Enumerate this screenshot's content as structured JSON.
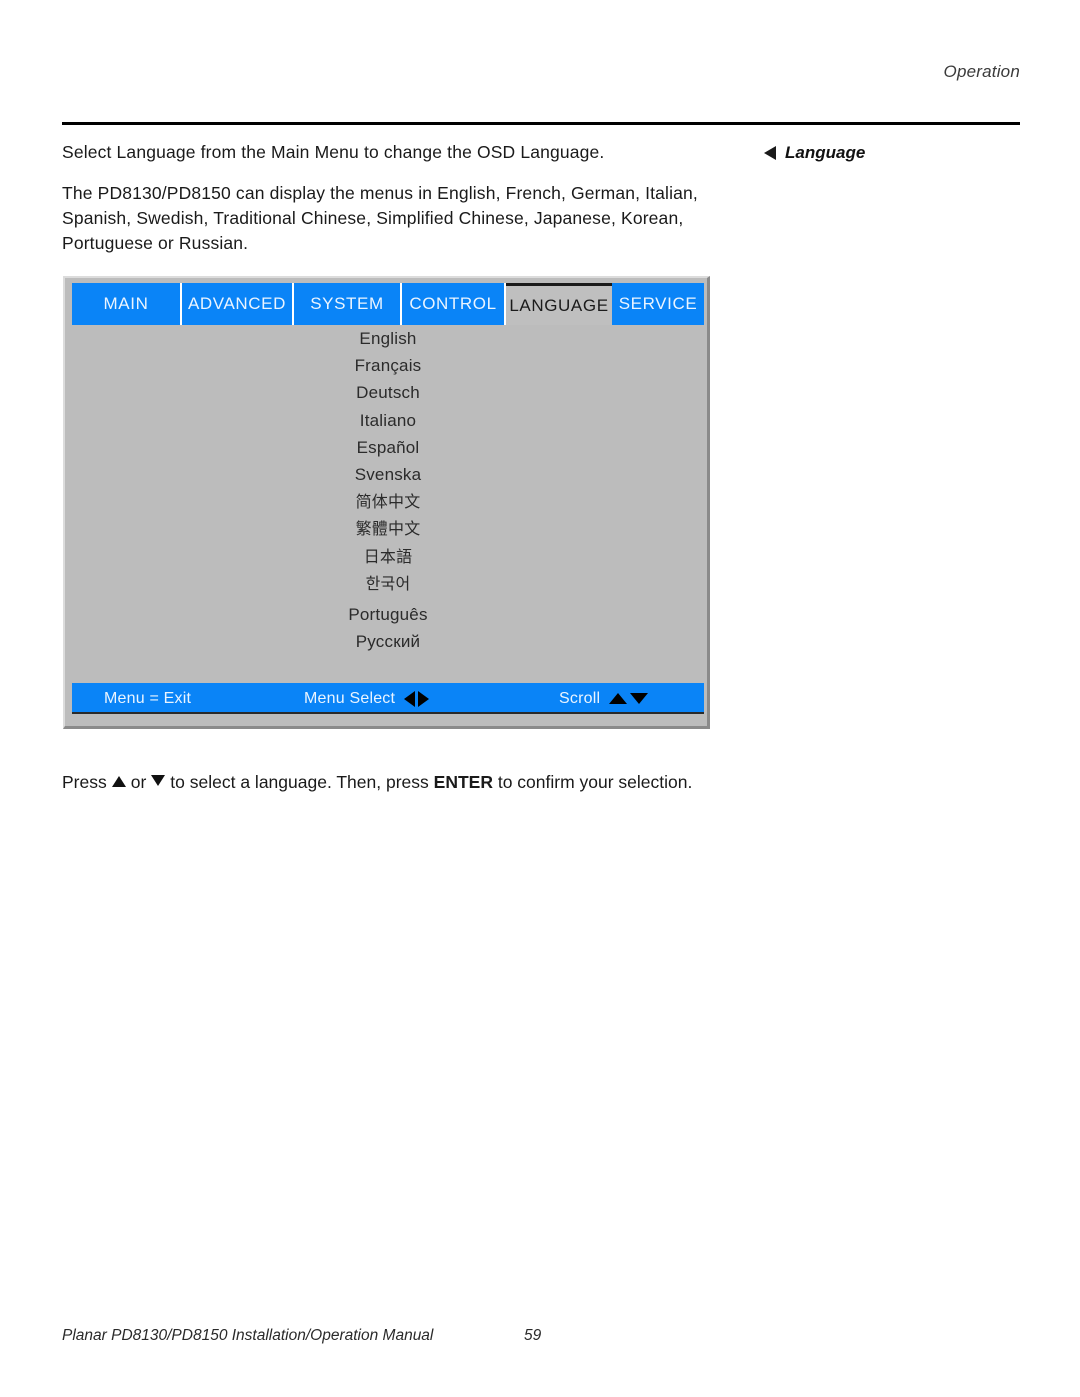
{
  "header": {
    "running_head": "Operation"
  },
  "body": {
    "paragraph_1": "Select Language from the Main Menu to change the OSD Language.",
    "paragraph_2": "The PD8130/PD8150 can display the menus in English, French, German, Italian, Spanish, Swedish, Traditional Chinese, Simplified Chinese, Japanese, Korean, Portuguese or Russian."
  },
  "margin_note": {
    "marker_icon": "triangle-left-icon",
    "label": "Language"
  },
  "osd": {
    "tabs": [
      {
        "label": "MAIN",
        "active": false
      },
      {
        "label": "ADVANCED",
        "active": false
      },
      {
        "label": "SYSTEM",
        "active": false
      },
      {
        "label": "CONTROL",
        "active": false
      },
      {
        "label": "LANGUAGE",
        "active": true
      },
      {
        "label": "SERVICE",
        "active": false
      }
    ],
    "languages": [
      "English",
      "Français",
      "Deutsch",
      "Italiano",
      "Español",
      "Svenska",
      "简体中文",
      "繁體中文",
      "日本語",
      "한국어",
      "Português",
      "Русский"
    ],
    "status_bar": {
      "exit": "Menu = Exit",
      "select": "Menu Select",
      "scroll": "Scroll",
      "select_icons": [
        "triangle-left-icon",
        "triangle-right-icon"
      ],
      "scroll_icons": [
        "triangle-up-icon",
        "triangle-down-icon"
      ]
    },
    "colors": {
      "tab_blue": "#0a84f7",
      "panel_gray": "#bcbcbc",
      "active_tab_gray": "#bfbfbf"
    }
  },
  "caption": {
    "press": "Press",
    "up_icon": "triangle-up-icon",
    "or": "or",
    "down_icon": "triangle-down-icon",
    "to_select": "to select a language. Then, press",
    "enter": "ENTER",
    "confirm": "to confirm your selection."
  },
  "footer": {
    "title": "Planar PD8130/PD8150 Installation/Operation Manual",
    "page_number": "59"
  }
}
